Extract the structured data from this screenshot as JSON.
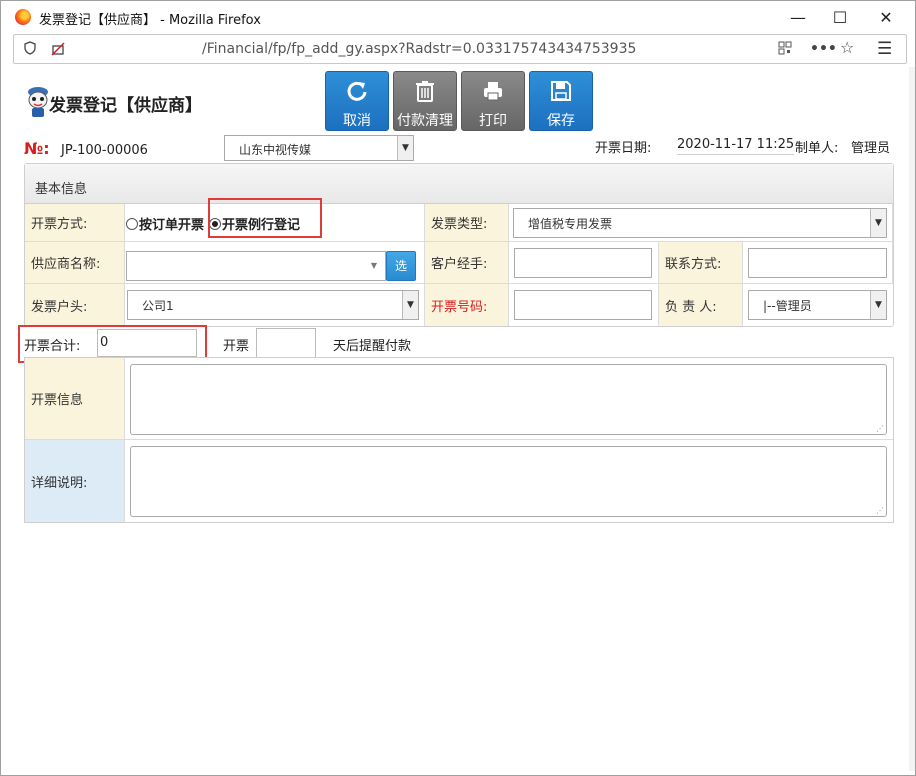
{
  "browser": {
    "title": "发票登记【供应商】 - Mozilla Firefox",
    "url": "/Financial/fp/fp_add_gy.aspx?Radstr=0.033175743434753935",
    "controls": {
      "minimize": "—",
      "maximize": "☐",
      "close": "✕"
    },
    "icons": [
      "shield-icon",
      "tracking-off-icon",
      "qr-code-icon",
      "more-icon",
      "bookmark-star-icon",
      "menu-icon"
    ]
  },
  "header": {
    "title": "发票登记【供应商】",
    "buttons": [
      {
        "label": "取消",
        "icon": "refresh-icon",
        "color": "#1c70bf"
      },
      {
        "label": "付款清理",
        "icon": "trash-icon",
        "color": "#6e6e6e"
      },
      {
        "label": "打印",
        "icon": "printer-icon",
        "color": "#6e6e6e"
      },
      {
        "label": "保存",
        "icon": "save-icon",
        "color": "#1c70bf"
      }
    ]
  },
  "meta": {
    "no_label": "№:",
    "no_value": "JP-100-00006",
    "supplier_select": "山东中视传媒",
    "date_label": "开票日期:",
    "date_value": "2020-11-17 11:25",
    "maker_label": "制单人:",
    "maker_value": "管理员"
  },
  "form": {
    "section": "基本信息",
    "method_label": "开票方式:",
    "method_options": [
      "按订单开票",
      "开票例行登记"
    ],
    "method_selected": "开票例行登记",
    "invoice_type_label": "发票类型:",
    "invoice_type_value": "增值税专用发票",
    "supplier_name_label": "供应商名称:",
    "supplier_name_value": "",
    "choose_button": "选",
    "client_agent_label": "客户经手:",
    "contact_label": "联系方式:",
    "invoice_account_label": "发票户头:",
    "invoice_account_value": "公司1",
    "invoice_number_label": "开票号码:",
    "owner_label": "负 责 人:",
    "owner_value": "|--管理员"
  },
  "totals": {
    "total_label": "开票合计:",
    "total_value": "0",
    "remind_prefix": "开票",
    "remind_days": "",
    "remind_suffix": "天后提醒付款"
  },
  "details": {
    "info_label": "开票信息",
    "desc_label": "详细说明:"
  },
  "highlight_color": "#e03b3b"
}
